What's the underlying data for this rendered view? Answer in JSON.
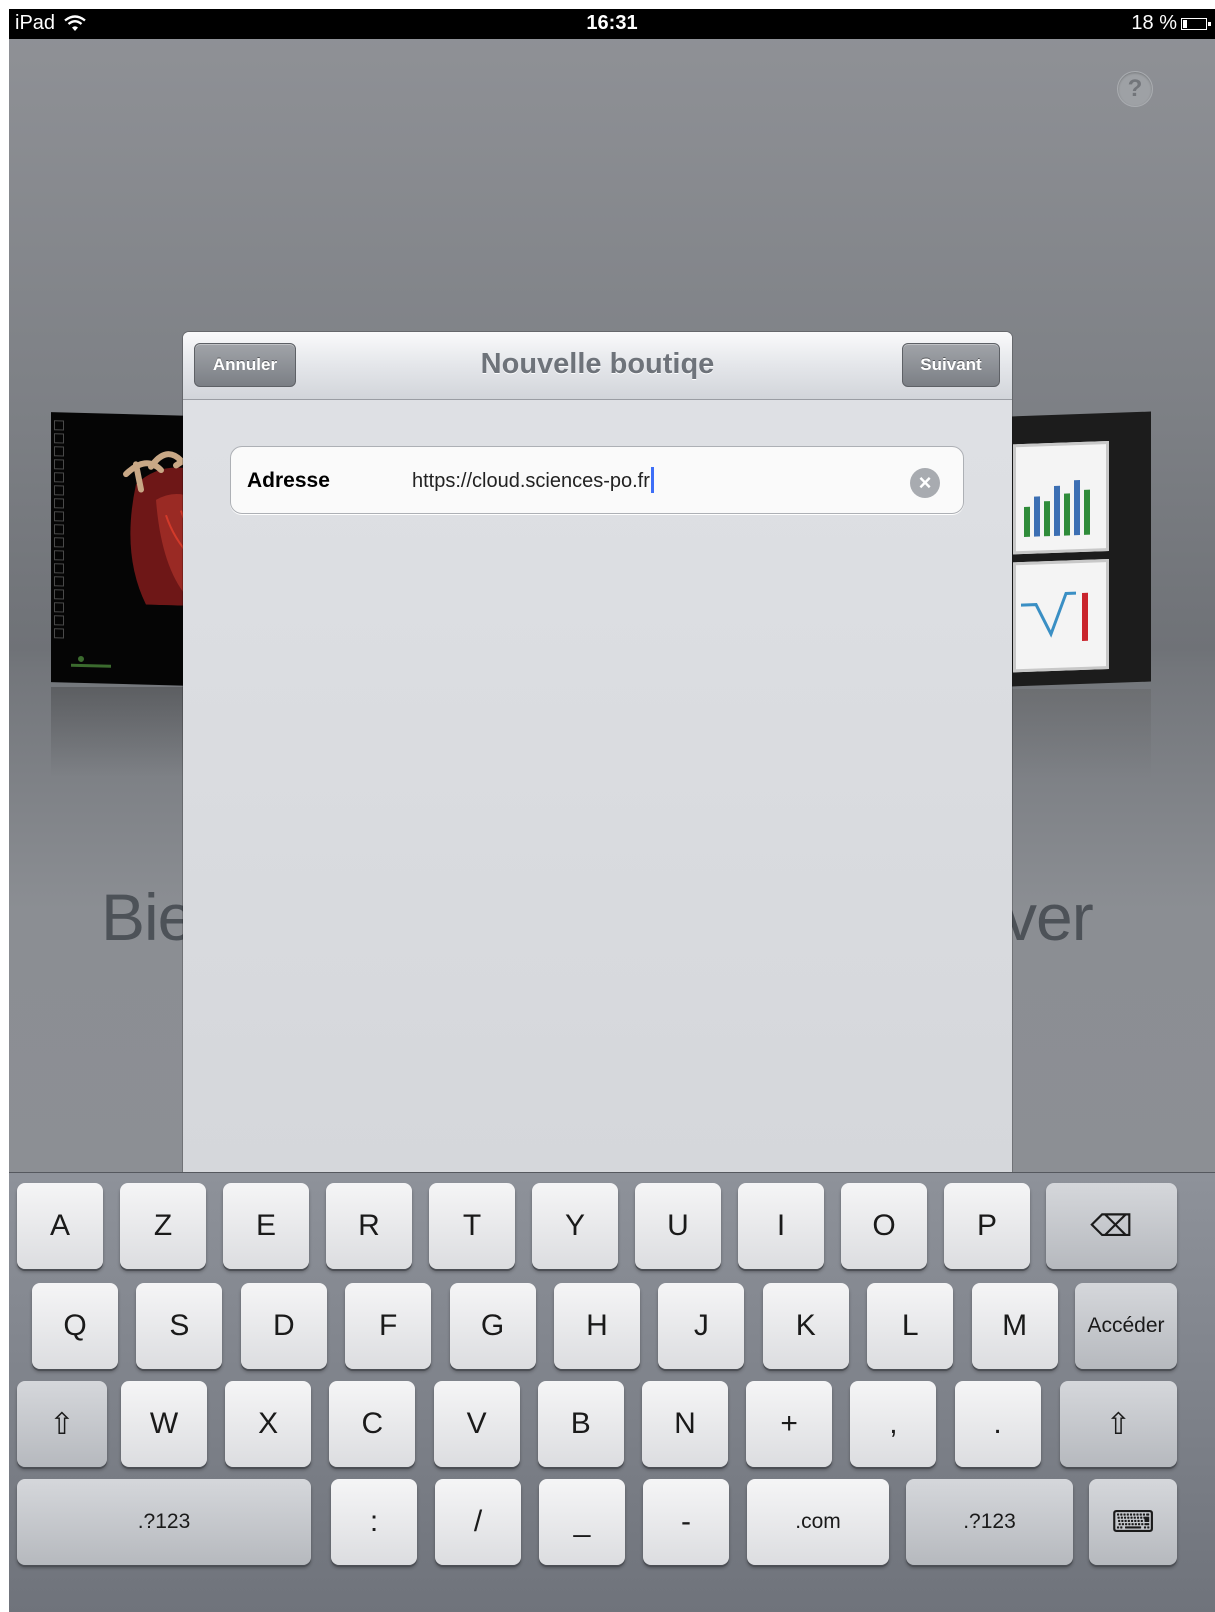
{
  "status_bar": {
    "device": "iPad",
    "time": "16:31",
    "battery_percent": "18 %",
    "battery_level": 0.18
  },
  "help": {
    "label": "?"
  },
  "background": {
    "welcome_left": "Bie",
    "welcome_right": "ver"
  },
  "dialog": {
    "title": "Nouvelle boutiqe",
    "cancel_label": "Annuler",
    "next_label": "Suivant",
    "address_label": "Adresse",
    "address_value": "https://cloud.sciences-po.fr"
  },
  "keyboard": {
    "row1": [
      "A",
      "Z",
      "E",
      "R",
      "T",
      "Y",
      "U",
      "I",
      "O",
      "P"
    ],
    "row2": [
      "Q",
      "S",
      "D",
      "F",
      "G",
      "H",
      "J",
      "K",
      "L",
      "M"
    ],
    "go_label": "Accéder",
    "row3": [
      "W",
      "X",
      "C",
      "V",
      "B",
      "N",
      "+",
      ",",
      "."
    ],
    "row4": [
      ".?123",
      ":",
      "/",
      "_",
      "-",
      ".com",
      ".?123"
    ],
    "shift_glyph": "⇧",
    "delete_glyph": "⌫",
    "hide_keyboard_glyph": "⌨"
  },
  "colors": {
    "accent_caret": "#3d6ef7",
    "nav_button": "#7b7f85",
    "title": "#6e737a"
  }
}
